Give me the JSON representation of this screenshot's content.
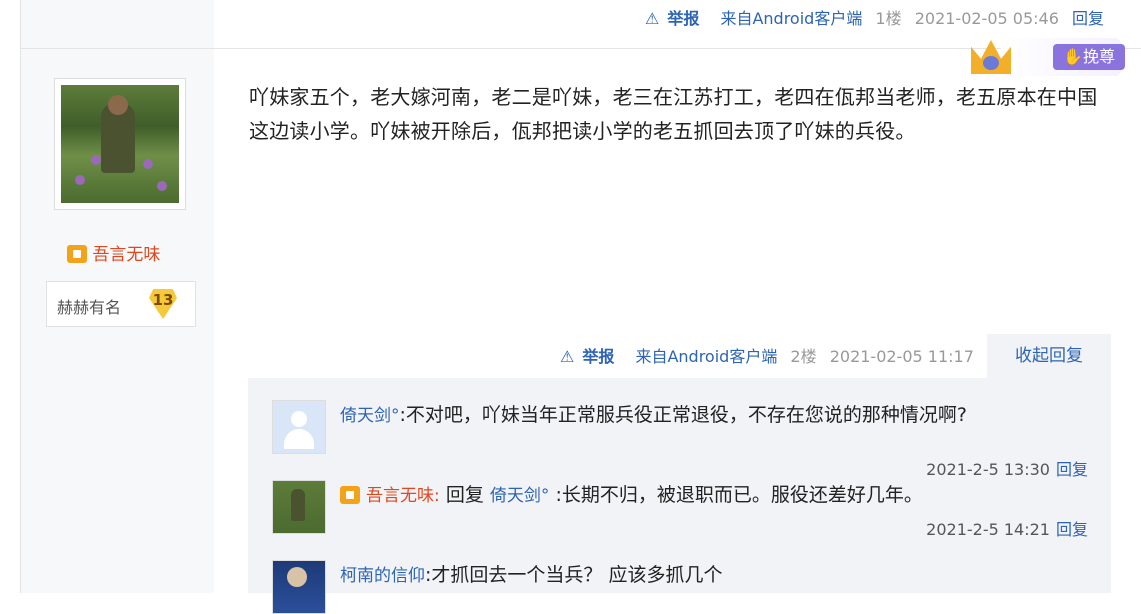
{
  "floor1": {
    "report": "举报",
    "client": "来自Android客户端",
    "floor": "1楼",
    "time": "2021-02-05 05:46",
    "reply": "回复"
  },
  "post": {
    "username": "吾言无味",
    "level_name": "赫赫有名",
    "level": "13",
    "vip_label": "挽尊",
    "text": "吖妹家五个，老大嫁河南，老二是吖妹，老三在江苏打工，老四在佤邦当老师，老五原本在中国这边读小学。吖妹被开除后，佤邦把读小学的老五抓回去顶了吖妹的兵役。",
    "report": "举报",
    "client": "来自Android客户端",
    "floor": "2楼",
    "time": "2021-02-05 11:17",
    "collapse": "收起回复"
  },
  "replies": [
    {
      "user": "倚天剑°",
      "sep": ":",
      "content": "不对吧，吖妹当年正常服兵役正常退役，不存在您说的那种情况啊?",
      "time": "2021-2-5 13:30",
      "reply": "回复"
    },
    {
      "user": "吾言无味",
      "prefix": "回复",
      "target": "倚天剑°",
      "sep": ":",
      "content": "长期不归，被退职而已。服役还差好几年。",
      "time": "2021-2-5 14:21",
      "reply": "回复"
    },
    {
      "user": "柯南的信仰",
      "sep": ":",
      "content": "才抓回去一个当兵？ 应该多抓几个"
    }
  ],
  "icons": {
    "report": "warning-triangle-icon",
    "member": "crown-member-icon"
  },
  "colors": {
    "link": "#2d64b3",
    "vip_name": "#e1471d",
    "meta": "#999999"
  }
}
